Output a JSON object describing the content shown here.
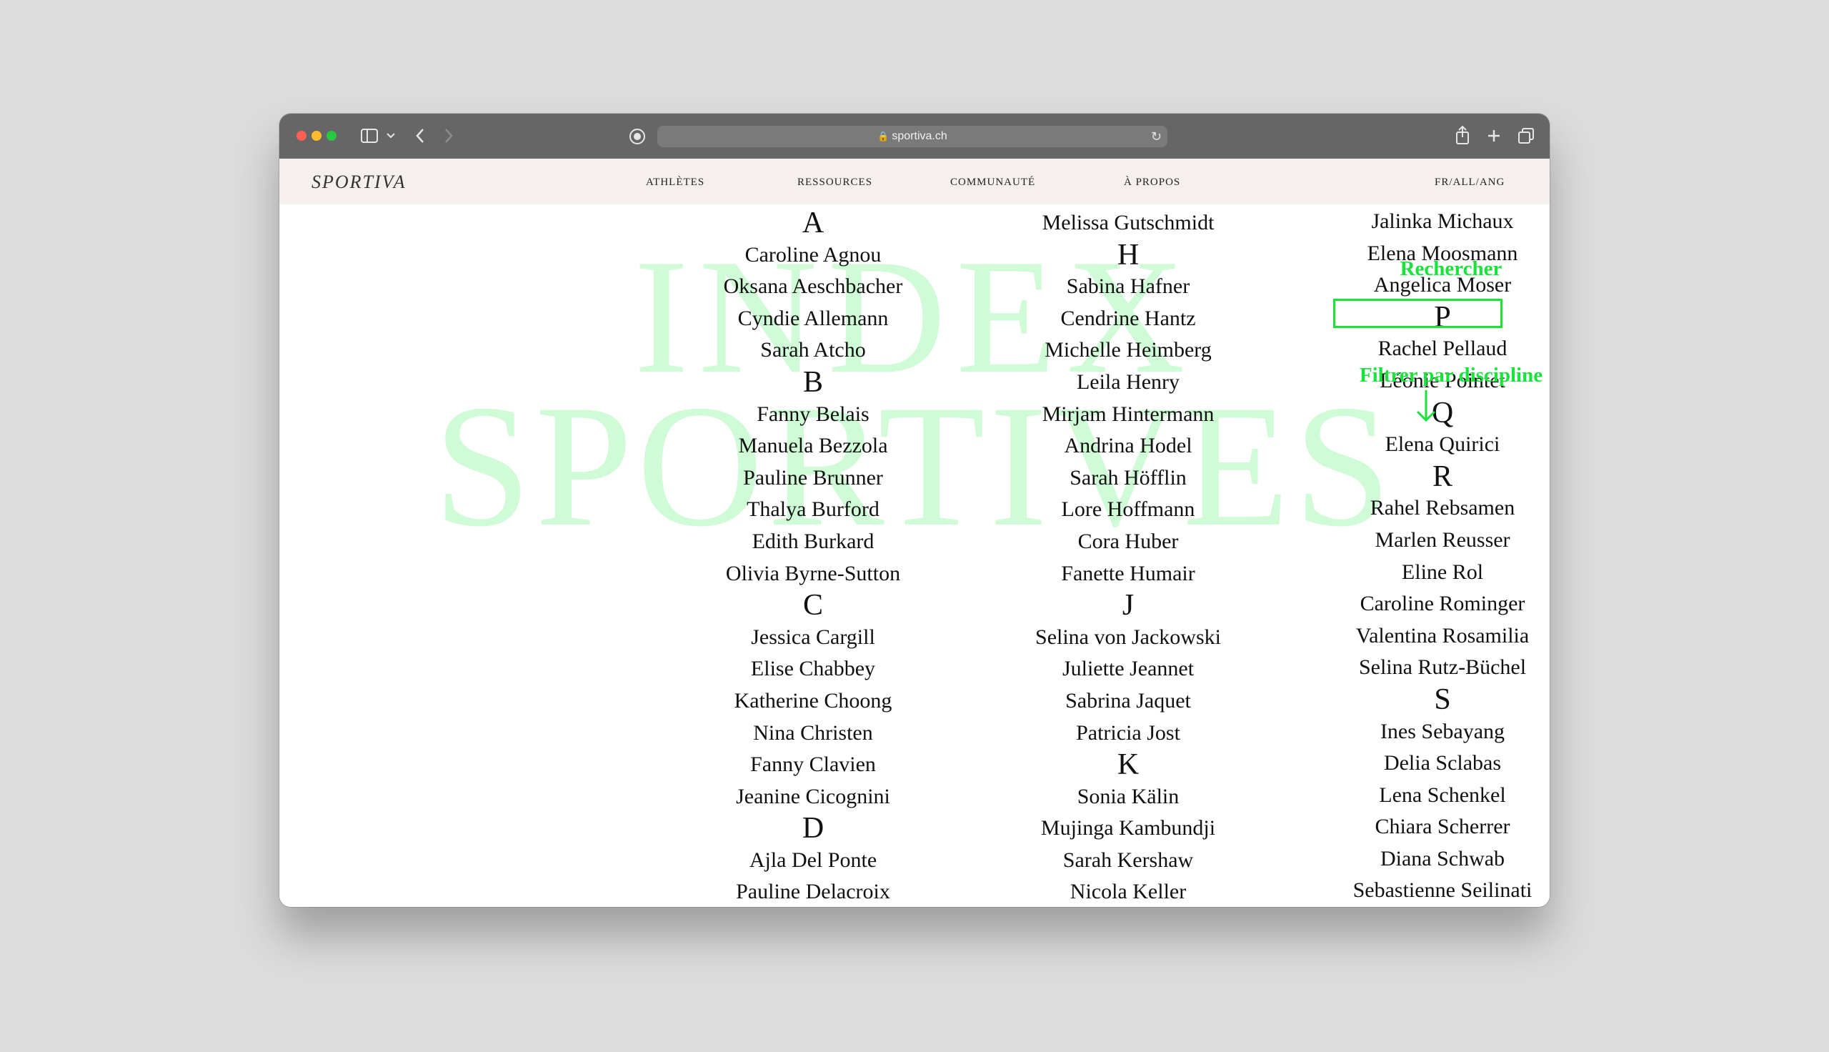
{
  "browser": {
    "url": "sportiva.ch"
  },
  "nav": {
    "brand": "SPORTIVA",
    "items": [
      "ATHLÈTES",
      "RESSOURCES",
      "COMMUNAUTÉ",
      "À PROPOS"
    ],
    "lang": "FR/ALL/ANG"
  },
  "background_title": {
    "line1": "INDEX",
    "line2": "SPORTIVES"
  },
  "sidebar": {
    "search_label": "Rechercher",
    "search_value": "",
    "filter_label": "Filtrer par discipline"
  },
  "columns": [
    [
      {
        "t": "letter",
        "v": "A"
      },
      {
        "t": "name",
        "v": "Caroline Agnou"
      },
      {
        "t": "name",
        "v": "Oksana Aeschbacher"
      },
      {
        "t": "name",
        "v": "Cyndie Allemann"
      },
      {
        "t": "name",
        "v": "Sarah Atcho"
      },
      {
        "t": "letter",
        "v": "B"
      },
      {
        "t": "name",
        "v": "Fanny Belais"
      },
      {
        "t": "name",
        "v": "Manuela Bezzola"
      },
      {
        "t": "name",
        "v": "Pauline Brunner"
      },
      {
        "t": "name",
        "v": "Thalya Burford"
      },
      {
        "t": "name",
        "v": "Edith Burkard"
      },
      {
        "t": "name",
        "v": "Olivia Byrne-Sutton"
      },
      {
        "t": "letter",
        "v": "C"
      },
      {
        "t": "name",
        "v": "Jessica Cargill"
      },
      {
        "t": "name",
        "v": "Elise Chabbey"
      },
      {
        "t": "name",
        "v": "Katherine Choong"
      },
      {
        "t": "name",
        "v": "Nina Christen"
      },
      {
        "t": "name",
        "v": "Fanny Clavien"
      },
      {
        "t": "name",
        "v": "Jeanine Cicognini"
      },
      {
        "t": "letter",
        "v": "D"
      },
      {
        "t": "name",
        "v": "Ajla Del Ponte"
      },
      {
        "t": "name",
        "v": "Pauline Delacroix"
      }
    ],
    [
      {
        "t": "name",
        "v": "Melissa Gutschmidt"
      },
      {
        "t": "letter",
        "v": "H"
      },
      {
        "t": "name",
        "v": "Sabina Hafner"
      },
      {
        "t": "name",
        "v": "Cendrine Hantz"
      },
      {
        "t": "name",
        "v": "Michelle Heimberg"
      },
      {
        "t": "name",
        "v": "Leila Henry"
      },
      {
        "t": "name",
        "v": "Mirjam Hintermann"
      },
      {
        "t": "name",
        "v": "Andrina Hodel"
      },
      {
        "t": "name",
        "v": "Sarah Höfflin"
      },
      {
        "t": "name",
        "v": "Lore Hoffmann"
      },
      {
        "t": "name",
        "v": "Cora Huber"
      },
      {
        "t": "name",
        "v": "Fanette Humair"
      },
      {
        "t": "letter",
        "v": "J"
      },
      {
        "t": "name",
        "v": "Selina von Jackowski"
      },
      {
        "t": "name",
        "v": "Juliette Jeannet"
      },
      {
        "t": "name",
        "v": "Sabrina Jaquet"
      },
      {
        "t": "name",
        "v": "Patricia Jost"
      },
      {
        "t": "letter",
        "v": "K"
      },
      {
        "t": "name",
        "v": "Sonia Kälin"
      },
      {
        "t": "name",
        "v": "Mujinga Kambundji"
      },
      {
        "t": "name",
        "v": "Sarah Kershaw"
      },
      {
        "t": "name",
        "v": "Nicola Keller"
      }
    ],
    [
      {
        "t": "name",
        "v": "Jalinka Michaux"
      },
      {
        "t": "name",
        "v": "Elena Moosmann"
      },
      {
        "t": "name",
        "v": "Angelica Moser"
      },
      {
        "t": "letter",
        "v": "P"
      },
      {
        "t": "name",
        "v": "Rachel Pellaud"
      },
      {
        "t": "name",
        "v": "Léonie Pointet"
      },
      {
        "t": "letter",
        "v": "Q"
      },
      {
        "t": "name",
        "v": "Elena Quirici"
      },
      {
        "t": "letter",
        "v": "R"
      },
      {
        "t": "name",
        "v": "Rahel Rebsamen"
      },
      {
        "t": "name",
        "v": "Marlen Reusser"
      },
      {
        "t": "name",
        "v": "Eline Rol"
      },
      {
        "t": "name",
        "v": "Caroline Rominger"
      },
      {
        "t": "name",
        "v": "Valentina Rosamilia"
      },
      {
        "t": "name",
        "v": "Selina Rutz-Büchel"
      },
      {
        "t": "letter",
        "v": "S"
      },
      {
        "t": "name",
        "v": "Ines Sebayang"
      },
      {
        "t": "name",
        "v": "Delia Sclabas"
      },
      {
        "t": "name",
        "v": "Lena Schenkel"
      },
      {
        "t": "name",
        "v": "Chiara Scherrer"
      },
      {
        "t": "name",
        "v": "Diana Schwab"
      },
      {
        "t": "name",
        "v": "Sebastienne Seilinati"
      }
    ]
  ]
}
